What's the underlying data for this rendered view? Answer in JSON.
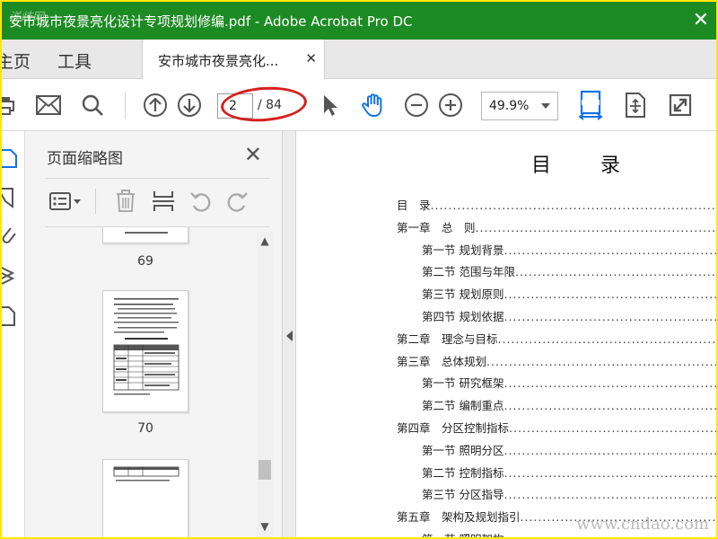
{
  "window": {
    "title": "安市城市夜景亮化设计专项规划修编.pdf - Adobe Acrobat Pro DC",
    "close_glyph": "✕",
    "watermark_topleft": "洋歧网"
  },
  "tabs": {
    "home": "主页",
    "tools": "工具",
    "document_tab": "安市城市夜景亮化...",
    "document_tab_close": "✕"
  },
  "toolbar": {
    "current_page": "2",
    "total_pages": "/ 84",
    "zoom": "49.9%",
    "icons": [
      "print-icon",
      "mail-icon",
      "search-icon",
      "prev-page-icon",
      "next-page-icon",
      "select-cursor-icon",
      "hand-tool-icon",
      "zoom-out-icon",
      "zoom-in-icon",
      "fit-width-icon",
      "fit-page-icon",
      "fullscreen-icon"
    ],
    "accent": "#1473e6",
    "annotation_color": "#d62020"
  },
  "panel": {
    "title": "页面缩略图",
    "close_glyph": "✕",
    "thumbnails": [
      {
        "page": "69"
      },
      {
        "page": "70"
      },
      {
        "page": ""
      }
    ]
  },
  "document": {
    "heading": "目 录",
    "toc": [
      {
        "text": "目　录",
        "level": 0
      },
      {
        "text": "第一章　总　则",
        "level": 0
      },
      {
        "text": "第一节 规划背景",
        "level": 1
      },
      {
        "text": "第二节 范围与年限",
        "level": 1
      },
      {
        "text": "第三节 规划原则",
        "level": 1
      },
      {
        "text": "第四节 规划依据",
        "level": 1
      },
      {
        "text": "第二章　理念与目标",
        "level": 0
      },
      {
        "text": "第三章　总体规划",
        "level": 0
      },
      {
        "text": "第一节 研究框架",
        "level": 1
      },
      {
        "text": "第二节 编制重点",
        "level": 1
      },
      {
        "text": "第四章　分区控制指标",
        "level": 0
      },
      {
        "text": "第一节 照明分区",
        "level": 1
      },
      {
        "text": "第二节 控制指标",
        "level": 1
      },
      {
        "text": "第三节 分区指导",
        "level": 1
      },
      {
        "text": "第五章　架构及规划指引",
        "level": 0
      },
      {
        "text": "第一节 照明架构",
        "level": 1
      }
    ],
    "watermark": "www.cndao.com"
  }
}
